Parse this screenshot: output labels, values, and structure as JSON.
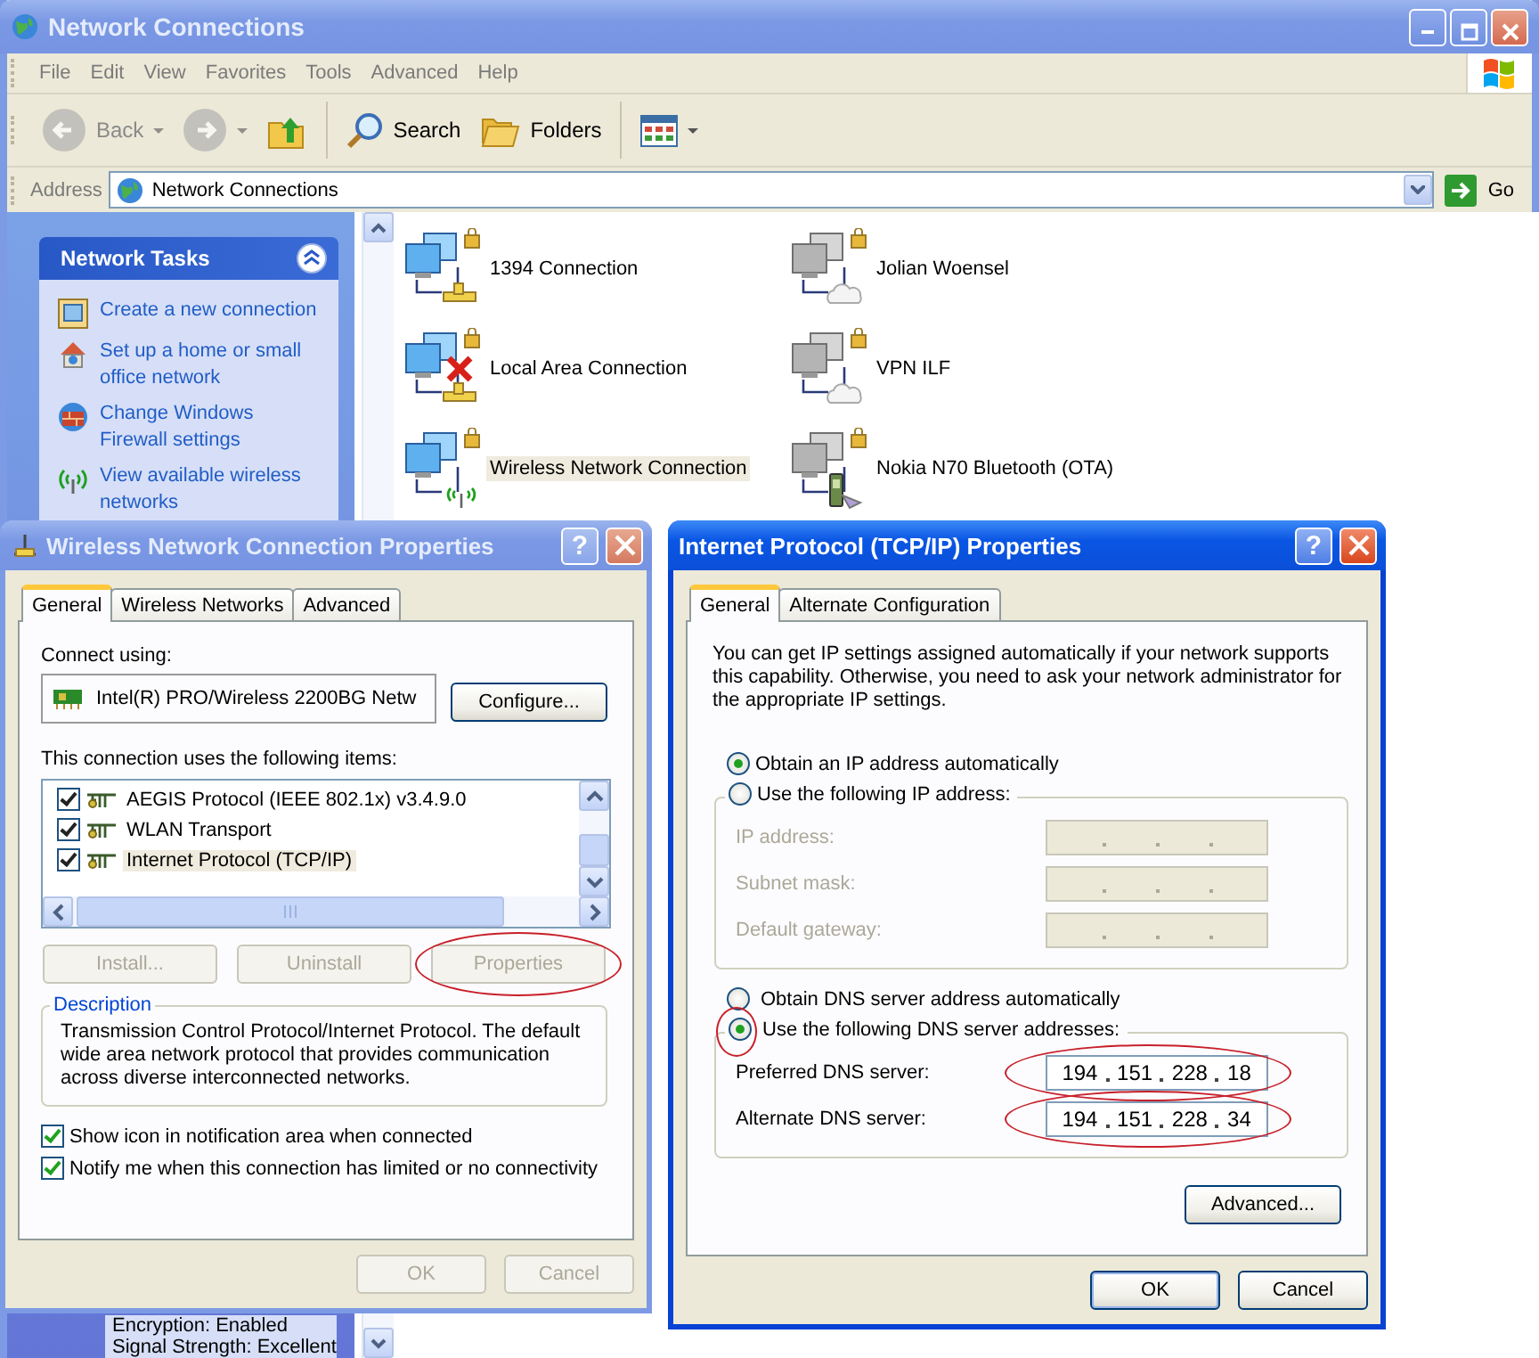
{
  "window": {
    "title": "Network Connections"
  },
  "menu": [
    "File",
    "Edit",
    "View",
    "Favorites",
    "Tools",
    "Advanced",
    "Help"
  ],
  "toolbar": [
    {
      "kind": "back",
      "label": "Back",
      "disabled": true
    },
    {
      "kind": "forward",
      "disabled": true
    },
    {
      "kind": "up",
      "disabled": false
    },
    {
      "kind": "search",
      "label": "Search",
      "disabled": false
    },
    {
      "kind": "folders",
      "label": "Folders",
      "disabled": false
    },
    {
      "kind": "views",
      "disabled": false
    }
  ],
  "address": {
    "label": "Address",
    "value": "Network Connections",
    "go": "Go"
  },
  "tasks": {
    "title": "Network Tasks",
    "expanded": true,
    "items": [
      {
        "kind": "new-connection",
        "label": "Create a new connection"
      },
      {
        "kind": "home-network",
        "label": "Set up a home or small office network"
      },
      {
        "kind": "firewall",
        "label": "Change Windows Firewall settings"
      },
      {
        "kind": "wireless",
        "label": "View available wireless networks"
      }
    ]
  },
  "details": [
    "Encryption: Enabled",
    "Signal Strength: Excellent"
  ],
  "connections": [
    {
      "name": "1394 Connection",
      "kind": "lan",
      "disconnected": false,
      "selected": false
    },
    {
      "name": "Jolian Woensel",
      "kind": "dialup",
      "disconnected": false,
      "selected": false
    },
    {
      "name": "Local Area Connection",
      "kind": "lan",
      "disconnected": true,
      "selected": false
    },
    {
      "name": "VPN ILF",
      "kind": "vpn",
      "disconnected": false,
      "selected": false
    },
    {
      "name": "Wireless Network Connection",
      "kind": "wireless",
      "disconnected": false,
      "selected": true
    },
    {
      "name": "Nokia N70 Bluetooth (OTA)",
      "kind": "bluetooth",
      "disconnected": false,
      "selected": false
    }
  ],
  "wireless_dialog": {
    "title": "Wireless Network Connection Properties",
    "active": false,
    "help": "?",
    "tabs": [
      {
        "label": "General",
        "selected": true
      },
      {
        "label": "Wireless Networks",
        "selected": false
      },
      {
        "label": "Advanced",
        "selected": false
      }
    ],
    "connect_label": "Connect using:",
    "adapter": "Intel(R) PRO/Wireless 2200BG Netw",
    "configure": "Configure...",
    "items_label": "This connection uses the following items:",
    "items": [
      {
        "label": "AEGIS Protocol (IEEE 802.1x) v3.4.9.0",
        "checked": true,
        "selected": false
      },
      {
        "label": "WLAN Transport",
        "checked": true,
        "selected": false
      },
      {
        "label": "Internet Protocol (TCP/IP)",
        "checked": true,
        "selected": true
      }
    ],
    "buttons": [
      {
        "label": "Install...",
        "disabled": true,
        "circled": false
      },
      {
        "label": "Uninstall",
        "disabled": true,
        "circled": false
      },
      {
        "label": "Properties",
        "disabled": true,
        "circled": true
      }
    ],
    "description": {
      "title": "Description",
      "text": "Transmission Control Protocol/Internet Protocol. The default wide area network protocol that provides communication across diverse interconnected networks."
    },
    "options": [
      {
        "label": "Show icon in notification area when connected",
        "checked": true
      },
      {
        "label": "Notify me when this connection has limited or no connectivity",
        "checked": true
      }
    ],
    "footer": [
      {
        "label": "OK",
        "disabled": true
      },
      {
        "label": "Cancel",
        "disabled": true
      }
    ]
  },
  "tcpip_dialog": {
    "title": "Internet Protocol (TCP/IP) Properties",
    "active": true,
    "help": "?",
    "tabs": [
      {
        "label": "General",
        "selected": true
      },
      {
        "label": "Alternate Configuration",
        "selected": false
      }
    ],
    "intro": "You can get IP settings assigned automatically if your network supports this capability. Otherwise, you need to ask your network administrator for the appropriate IP settings.",
    "ip_options": [
      {
        "label": "Obtain an IP address automatically",
        "selected": true
      },
      {
        "label": "Use the following IP address:",
        "selected": false
      }
    ],
    "ip_fields": [
      {
        "label": "IP address:",
        "disabled": true
      },
      {
        "label": "Subnet mask:",
        "disabled": true
      },
      {
        "label": "Default gateway:",
        "disabled": true
      }
    ],
    "dns_options": [
      {
        "label": "Obtain DNS server address automatically",
        "selected": false,
        "circled": false
      },
      {
        "label": "Use the following DNS server addresses:",
        "selected": true,
        "circled": true
      }
    ],
    "dns_fields": [
      {
        "label": "Preferred DNS server:",
        "disabled": false,
        "octets": [
          "194",
          "151",
          "228",
          "18"
        ],
        "circled": true
      },
      {
        "label": "Alternate DNS server:",
        "disabled": false,
        "octets": [
          "194",
          "151",
          "228",
          "34"
        ],
        "circled": true
      }
    ],
    "advanced": "Advanced...",
    "footer": [
      {
        "label": "OK",
        "disabled": false
      },
      {
        "label": "Cancel",
        "disabled": false
      }
    ]
  }
}
